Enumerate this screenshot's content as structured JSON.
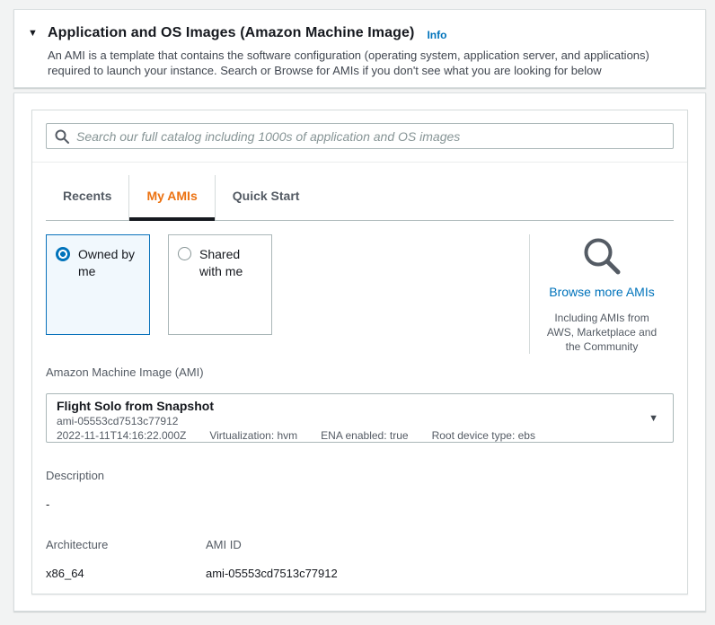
{
  "colors": {
    "accent_blue": "#0073bb",
    "tab_active_orange": "#ec7211",
    "selected_card_bg": "#f1f8fd",
    "selected_card_border": "#0a72bb",
    "active_tab_underline": "#16191f",
    "page_background": "#f2f3f3"
  },
  "header": {
    "title": "Application and OS Images (Amazon Machine Image)",
    "info_label": "Info",
    "description": "An AMI is a template that contains the software configuration (operating system, application server, and applications) required to launch your instance. Search or Browse for AMIs if you don't see what you are looking for below"
  },
  "search": {
    "placeholder": "Search our full catalog including 1000s of application and OS images"
  },
  "tabs": [
    {
      "label": "Recents",
      "active": false
    },
    {
      "label": "My AMIs",
      "active": true
    },
    {
      "label": "Quick Start",
      "active": false
    }
  ],
  "filters": [
    {
      "label": "Owned by me",
      "selected": true
    },
    {
      "label": "Shared with me",
      "selected": false
    }
  ],
  "browse": {
    "link": "Browse more AMIs",
    "note_lines": [
      "Including AMIs from",
      "AWS, Marketplace and",
      "the Community"
    ]
  },
  "ami_select": {
    "label": "Amazon Machine Image (AMI)",
    "name": "Flight Solo from Snapshot",
    "ami_id": "ami-05553cd7513c77912",
    "meta": [
      "2022-11-11T14:16:22.000Z",
      "Virtualization: hvm",
      "ENA enabled: true",
      "Root device type: ebs"
    ]
  },
  "details": {
    "description_label": "Description",
    "description_value": "-",
    "architecture_label": "Architecture",
    "architecture_value": "x86_64",
    "ami_id_label": "AMI ID",
    "ami_id_value": "ami-05553cd7513c77912"
  }
}
